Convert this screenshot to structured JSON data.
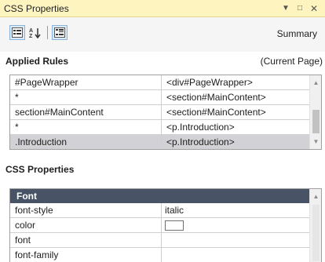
{
  "window": {
    "title": "CSS Properties",
    "dropdown_icon": "dropdown-arrow-icon",
    "maximize_icon": "maximize-icon",
    "close_icon": "close-icon"
  },
  "toolbar": {
    "buttons": [
      {
        "icon": "categorized-view-icon",
        "pressed": true
      },
      {
        "icon": "alphabetical-sort-icon",
        "pressed": false
      },
      {
        "icon": "show-set-properties-icon",
        "pressed": true
      }
    ],
    "summary_label": "Summary"
  },
  "applied_rules": {
    "heading": "Applied Rules",
    "scope": "(Current Page)",
    "rows": [
      {
        "selector": "#PageWrapper",
        "element": "<div#PageWrapper>"
      },
      {
        "selector": "*",
        "element": "<section#MainContent>"
      },
      {
        "selector": "section#MainContent",
        "element": "<section#MainContent>"
      },
      {
        "selector": "*",
        "element": "<p.Introduction>"
      },
      {
        "selector": ".Introduction",
        "element": "<p.Introduction>"
      }
    ]
  },
  "css_properties": {
    "heading": "CSS Properties",
    "category": "Font",
    "rows": [
      {
        "name": "font-style",
        "value": "italic"
      },
      {
        "name": "color",
        "value": ""
      },
      {
        "name": "font",
        "value": ""
      },
      {
        "name": "font-family",
        "value": ""
      }
    ]
  },
  "colors": {
    "title_bar": "#fdf4bf",
    "category_header": "#485466",
    "selected_row": "#d2d2d6"
  }
}
